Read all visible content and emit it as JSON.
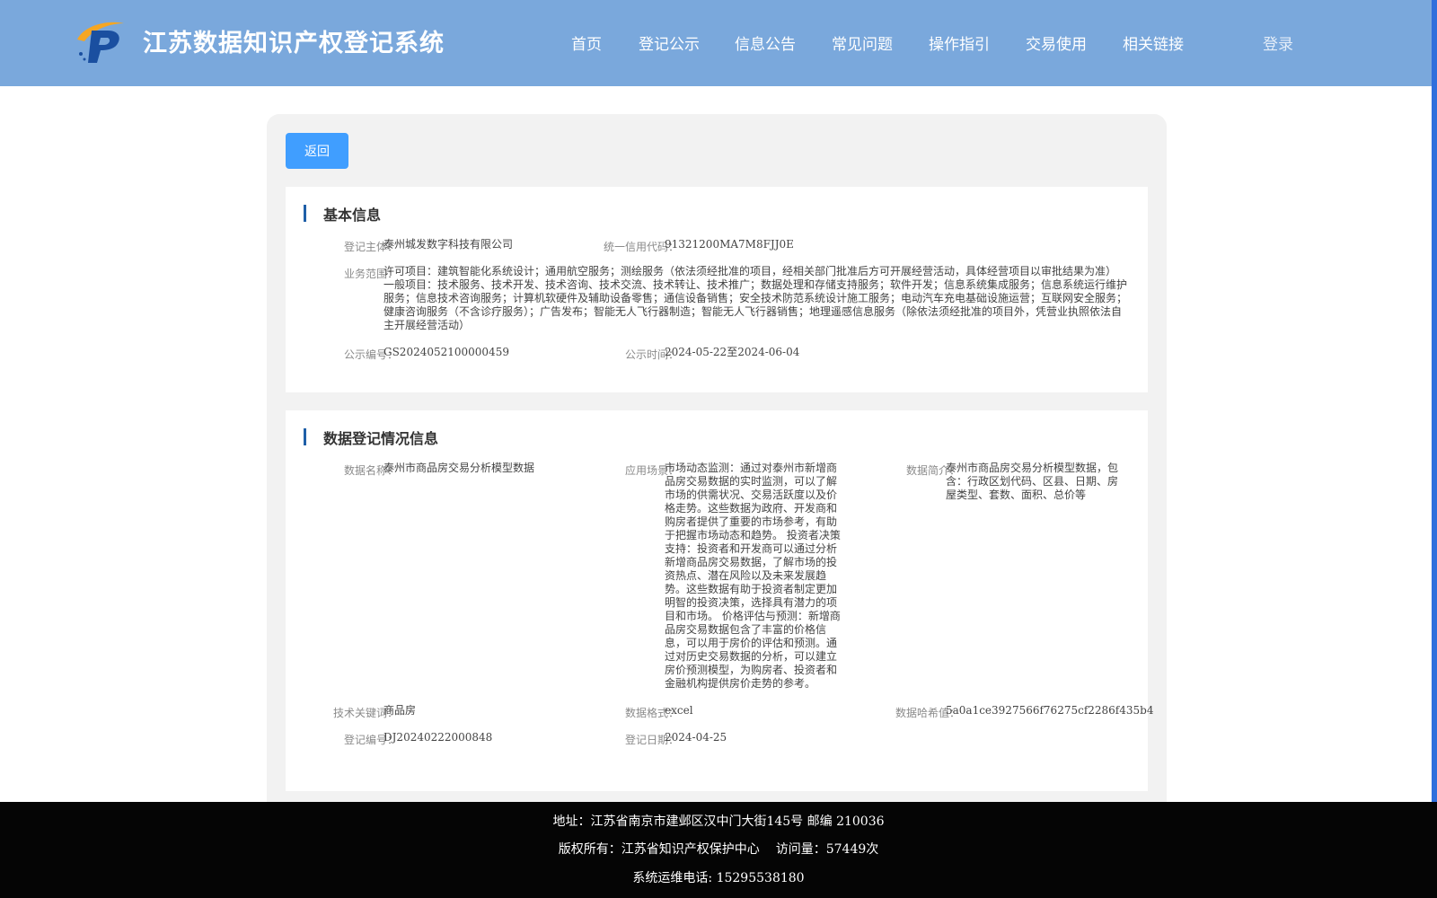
{
  "colors": {
    "header_bg": "#7aa8dc",
    "panel_bg": "#f2f2f2",
    "button_bg": "#409eff",
    "section_accent": "#1f5fa8",
    "footer_bg": "#050505"
  },
  "header": {
    "logo_icon": "system-logo",
    "title": "江苏数据知识产权登记系统",
    "nav": [
      "首页",
      "登记公示",
      "信息公告",
      "常见问题",
      "操作指引",
      "交易使用",
      "相关链接"
    ],
    "login": "登录"
  },
  "back_label": "返回",
  "basic_info": {
    "title": "基本信息",
    "subject_label": "登记主体：",
    "subject_value": "泰州城发数字科技有限公司",
    "credit_code_label": "统一信用代码：",
    "credit_code_value": "91321200MA7M8FJJ0E",
    "scope_label": "业务范围：",
    "scope_value": "许可项目：建筑智能化系统设计；通用航空服务；测绘服务（依法须经批准的项目，经相关部门批准后方可开展经营活动，具体经营项目以审批结果为准） 一般项目：技术服务、技术开发、技术咨询、技术交流、技术转让、技术推广；数据处理和存储支持服务；软件开发；信息系统集成服务；信息系统运行维护服务；信息技术咨询服务；计算机软硬件及辅助设备零售；通信设备销售；安全技术防范系统设计施工服务；电动汽车充电基础设施运营；互联网安全服务；健康咨询服务（不含诊疗服务）；广告发布；智能无人飞行器制造；智能无人飞行器销售；地理遥感信息服务（除依法须经批准的项目外，凭营业执照依法自主开展经营活动）",
    "pub_no_label": "公示编号：",
    "pub_no_value": "GS2024052100000459",
    "pub_time_label": "公示时间：",
    "pub_time_value": "2024-05-22至2024-06-04"
  },
  "data_info": {
    "title": "数据登记情况信息",
    "name_label": "数据名称：",
    "name_value": "泰州市商品房交易分析模型数据",
    "scenario_label": "应用场景：",
    "scenario_value": "市场动态监测：通过对泰州市新增商品房交易数据的实时监测，可以了解市场的供需状况、交易活跃度以及价格走势。这些数据为政府、开发商和购房者提供了重要的市场参考，有助于把握市场动态和趋势。 投资者决策支持：投资者和开发商可以通过分析新增商品房交易数据，了解市场的投资热点、潜在风险以及未来发展趋势。这些数据有助于投资者制定更加明智的投资决策，选择具有潜力的项目和市场。 价格评估与预测：新增商品房交易数据包含了丰富的价格信息，可以用于房价的评估和预测。通过对历史交易数据的分析，可以建立房价预测模型，为购房者、投资者和金融机构提供房价走势的参考。",
    "intro_label": "数据简介：",
    "intro_value": "泰州市商品房交易分析模型数据，包含：行政区划代码、区县、日期、房屋类型、套数、面积、总价等",
    "keyword_label": "技术关键词：",
    "keyword_value": "商品房",
    "format_label": "数据格式：",
    "format_value": "excel",
    "hash_label": "数据哈希值：",
    "hash_value": "5a0a1ce3927566f76275cf2286f435b4",
    "reg_no_label": "登记编号：",
    "reg_no_value": "DJ20240222000848",
    "reg_date_label": "登记日期：",
    "reg_date_value": "2024-04-25"
  },
  "footer": {
    "address": "地址：江苏省南京市建邺区汉中门大街145号 邮编 210036",
    "copyright": "版权所有：江苏省知识产权保护中心",
    "visits": "访问量：57449次",
    "phone": "系统运维电话: 15295538180"
  }
}
